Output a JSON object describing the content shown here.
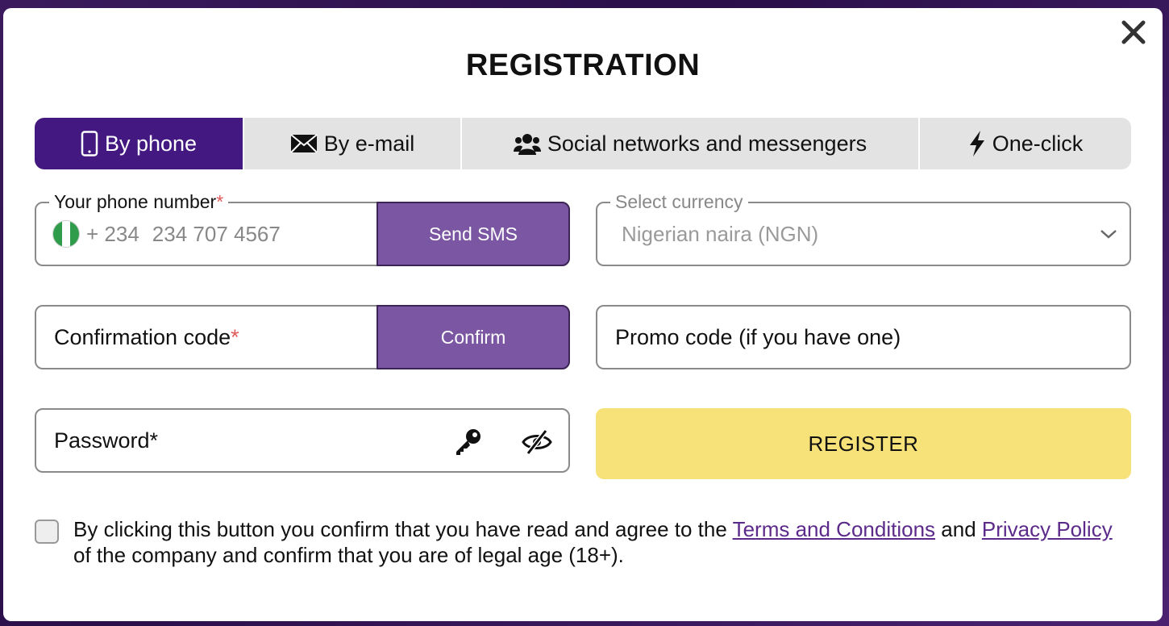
{
  "modal": {
    "title": "REGISTRATION"
  },
  "tabs": [
    {
      "label": "By phone",
      "icon": "smartphone-icon",
      "active": true
    },
    {
      "label": "By e-mail",
      "icon": "envelope-icon",
      "active": false
    },
    {
      "label": "Social networks and messengers",
      "icon": "users-icon",
      "active": false
    },
    {
      "label": "One-click",
      "icon": "lightning-icon",
      "active": false
    }
  ],
  "phone": {
    "label": "Your phone number",
    "required_mark": "*",
    "country_code": "+ 234",
    "placeholder": "234 707 4567",
    "send_button": "Send SMS"
  },
  "currency": {
    "label": "Select currency",
    "value": "Nigerian naira (NGN)"
  },
  "confirmation": {
    "label": "Confirmation code",
    "required_mark": "*",
    "confirm_button": "Confirm"
  },
  "promo": {
    "label": "Promo code (if you have one)"
  },
  "password": {
    "label": "Password*"
  },
  "register_button": "REGISTER",
  "agreement": {
    "text_before": "By clicking this button you confirm that you have read and agree to the ",
    "terms_link": "Terms and Conditions",
    "text_middle": " and ",
    "privacy_link": "Privacy Policy",
    "text_after": " of the company and confirm that you are of legal age (18+)."
  },
  "colors": {
    "active_tab": "#431880",
    "side_button": "#7b56a2",
    "register": "#f7e27a",
    "link": "#5b2a8a",
    "required": "#e05a5a"
  }
}
